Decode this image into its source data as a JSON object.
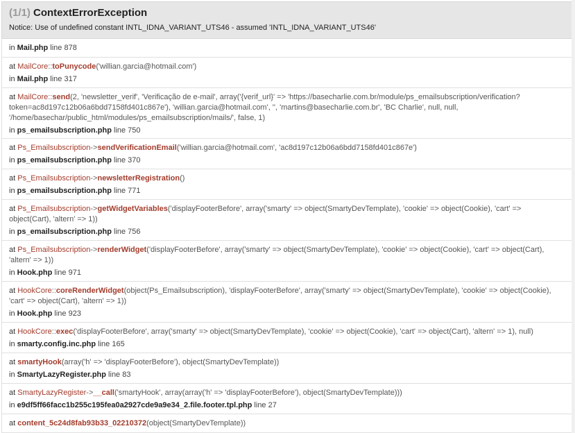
{
  "header": {
    "count": "(1/1)",
    "title": "ContextErrorException",
    "notice": "Notice: Use of undefined constant INTL_IDNA_VARIANT_UTS46 - assumed 'INTL_IDNA_VARIANT_UTS46'"
  },
  "in_label": "in",
  "at_label": "at",
  "line_label": "line",
  "frames": [
    {
      "at": "",
      "lines": [],
      "file": "Mail.php",
      "line": "878"
    },
    {
      "at_class": "MailCore",
      "at_sep": "::",
      "at_fn": "toPunycode",
      "lines": [
        "('willian.garcia@hotmail.com')"
      ],
      "file": "Mail.php",
      "line": "317"
    },
    {
      "at_class": "MailCore",
      "at_sep": "::",
      "at_fn": "send",
      "lines": [
        "(2, 'newsletter_verif', 'Verificação de e-mail', array('{verif_url}' => 'https://basecharlie.com.br/module/ps_emailsubscription/verification?",
        "token=ac8d197c12b06a6bdd7158fd401c867e'), 'willian.garcia@hotmail.com', '', 'martins@basecharlie.com.br', 'BC Charlie', null, null,",
        "'/home/basechar/public_html/modules/ps_emailsubscription/mails/', false, 1)"
      ],
      "file": "ps_emailsubscription.php",
      "line": "750"
    },
    {
      "at_class": "Ps_Emailsubscription",
      "at_sep": "->",
      "at_fn": "sendVerificationEmail",
      "lines": [
        "('willian.garcia@hotmail.com', 'ac8d197c12b06a6bdd7158fd401c867e')"
      ],
      "file": "ps_emailsubscription.php",
      "line": "370"
    },
    {
      "at_class": "Ps_Emailsubscription",
      "at_sep": "->",
      "at_fn": "newsletterRegistration",
      "lines": [
        "()"
      ],
      "file": "ps_emailsubscription.php",
      "line": "771"
    },
    {
      "at_class": "Ps_Emailsubscription",
      "at_sep": "->",
      "at_fn": "getWidgetVariables",
      "lines": [
        "('displayFooterBefore', array('smarty' => object(SmartyDevTemplate), 'cookie' => object(Cookie), 'cart' =>",
        "object(Cart), 'altern' => 1))"
      ],
      "file": "ps_emailsubscription.php",
      "line": "756"
    },
    {
      "at_class": "Ps_Emailsubscription",
      "at_sep": "->",
      "at_fn": "renderWidget",
      "lines": [
        "('displayFooterBefore', array('smarty' => object(SmartyDevTemplate), 'cookie' => object(Cookie), 'cart' => object(Cart),",
        "'altern' => 1))"
      ],
      "file": "Hook.php",
      "line": "971"
    },
    {
      "at_class": "HookCore",
      "at_sep": "::",
      "at_fn": "coreRenderWidget",
      "lines": [
        "(object(Ps_Emailsubscription), 'displayFooterBefore', array('smarty' => object(SmartyDevTemplate), 'cookie' => object(Cookie),",
        "'cart' => object(Cart), 'altern' => 1))"
      ],
      "file": "Hook.php",
      "line": "923"
    },
    {
      "at_class": "HookCore",
      "at_sep": "::",
      "at_fn": "exec",
      "lines": [
        "('displayFooterBefore', array('smarty' => object(SmartyDevTemplate), 'cookie' => object(Cookie), 'cart' => object(Cart), 'altern' => 1), null)"
      ],
      "file": "smarty.config.inc.php",
      "line": "165"
    },
    {
      "at_class": "",
      "at_sep": "",
      "at_fn": "smartyHook",
      "lines": [
        "(array('h' => 'displayFooterBefore'), object(SmartyDevTemplate))"
      ],
      "file": "SmartyLazyRegister.php",
      "line": "83"
    },
    {
      "at_class": "SmartyLazyRegister",
      "at_sep": "->",
      "at_fn": "__call",
      "lines": [
        "('smartyHook', array(array('h' => 'displayFooterBefore'), object(SmartyDevTemplate)))"
      ],
      "file": "e9df5ff66facc1b255c195fea0a2927cde9a9e34_2.file.footer.tpl.php",
      "line": "27"
    },
    {
      "at_class": "",
      "at_sep": "",
      "at_fn": "content_5c24d8fab93b33_02210372",
      "lines": [
        "(object(SmartyDevTemplate))"
      ],
      "file": "",
      "line": ""
    }
  ]
}
